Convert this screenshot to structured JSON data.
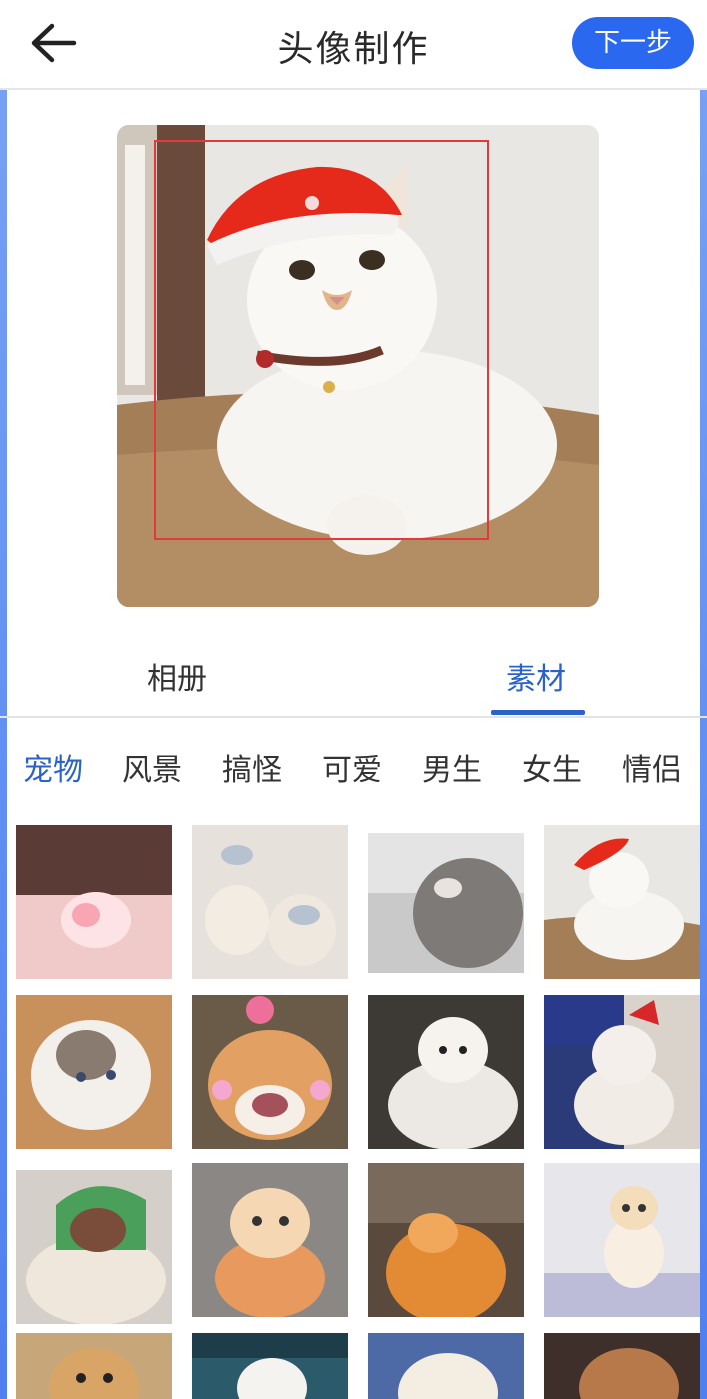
{
  "header": {
    "title": "头像制作",
    "next_label": "下一步",
    "back_icon": "arrow-left-icon"
  },
  "preview": {
    "image": "white-cat-with-santa-hat-photo",
    "crop_frame_color": "#e23a3a"
  },
  "tabs": {
    "items": [
      {
        "label": "相册",
        "active": false
      },
      {
        "label": "素材",
        "active": true
      }
    ],
    "active_color": "#2b62c9"
  },
  "categories": {
    "items": [
      "宠物",
      "风景",
      "搞怪",
      "可爱",
      "男生",
      "女生",
      "情侣"
    ],
    "active_index": 0
  },
  "thumbnails": [
    {
      "subject": "pink-paw"
    },
    {
      "subject": "two-hedgehogs"
    },
    {
      "subject": "grey-cat-looking-up"
    },
    {
      "subject": "cat-santa-hat"
    },
    {
      "subject": "ragdoll-cat"
    },
    {
      "subject": "smiling-shiba"
    },
    {
      "subject": "white-dog-in-blanket"
    },
    {
      "subject": "cat-with-bow-hat"
    },
    {
      "subject": "bulldog-with-hat"
    },
    {
      "subject": "cat-in-orange-towel"
    },
    {
      "subject": "orange-cat-paw"
    },
    {
      "subject": "cream-kitten"
    },
    {
      "subject": "french-bulldog"
    },
    {
      "subject": "white-puppy"
    },
    {
      "subject": "fluffy-cat"
    },
    {
      "subject": "brown-dog"
    }
  ]
}
